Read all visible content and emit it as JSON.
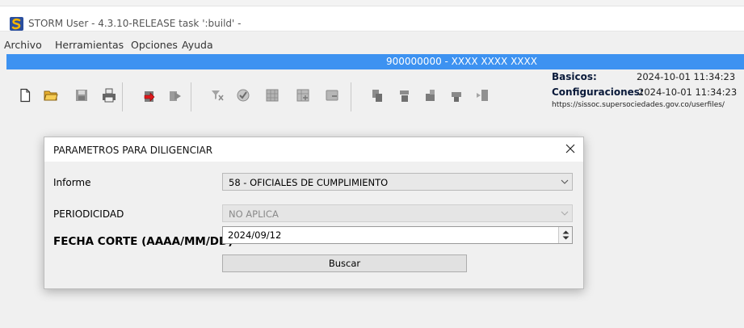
{
  "window": {
    "title": "STORM User - 4.3.10-RELEASE  task ':build' -",
    "app_icon": "storm-logo-icon"
  },
  "menu": {
    "items": [
      {
        "label": "Archivo"
      },
      {
        "label": "Herramientas"
      },
      {
        "label": "Opciones"
      },
      {
        "label": "Ayuda"
      }
    ]
  },
  "header_bar": {
    "text": "900000000 - XXXX XXXX XXXX",
    "color": "#3d92f1"
  },
  "toolbar": {
    "icons": [
      "new-document-icon",
      "open-folder-icon",
      "save-icon",
      "print-icon",
      "import-icon",
      "forward-icon",
      "filter-icon",
      "validate-icon",
      "grid-icon",
      "grid-add-icon",
      "grid-remove-icon",
      "tool-1-icon",
      "tool-2-icon",
      "tool-3-icon",
      "tool-4-icon",
      "tool-5-icon"
    ]
  },
  "info_panel": {
    "basicos_label": "Basicos:",
    "basicos_value": "2024-10-01 11:34:23",
    "config_label": "Configuraciones:",
    "config_value": "2024-10-01 11:34:23",
    "url": "https://sissoc.supersociedades.gov.co/userfiles/"
  },
  "dialog": {
    "title": "PARAMETROS PARA DILIGENCIAR",
    "informe_label": "Informe",
    "informe_value": "58 - OFICIALES DE CUMPLIMIENTO",
    "periodicidad_label": "PERIODICIDAD",
    "periodicidad_value": "NO APLICA",
    "fecha_label": "FECHA CORTE (AAAA/MM/DD)",
    "fecha_value": "2024/09/12",
    "search_label": "Buscar"
  }
}
